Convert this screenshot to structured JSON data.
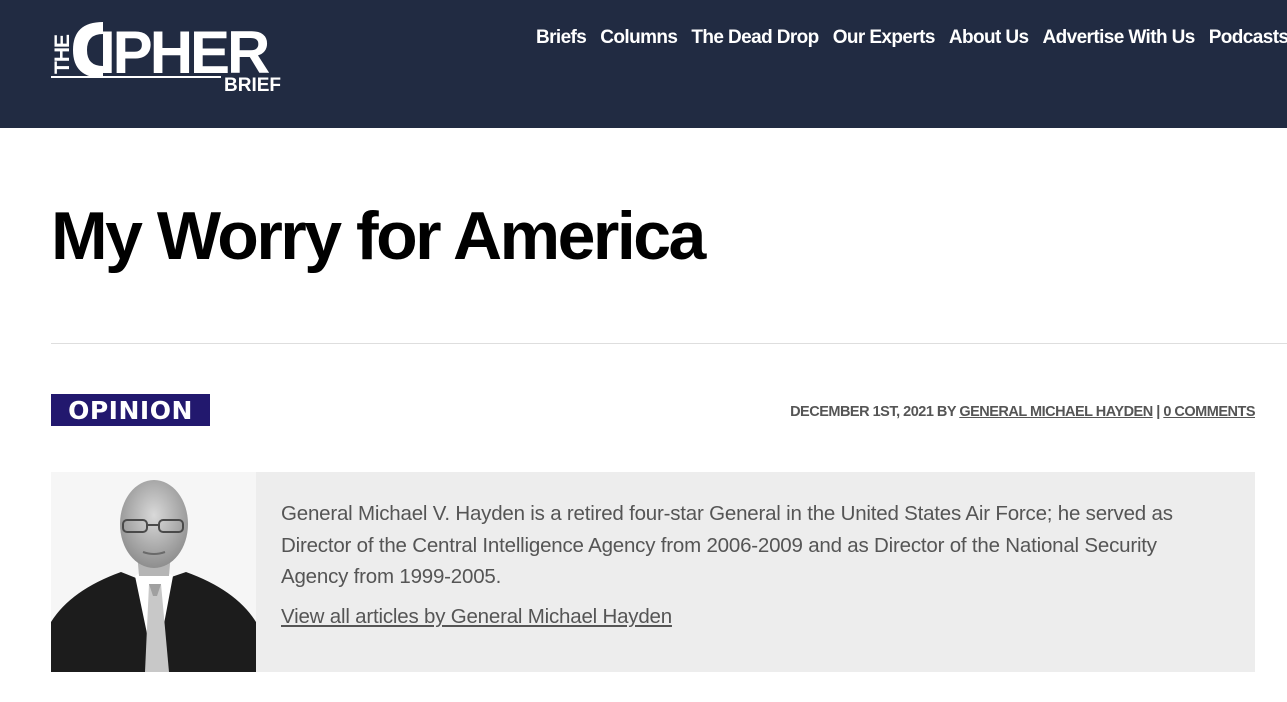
{
  "header": {
    "logo": {
      "the": "THE",
      "cipher": "CIPHER",
      "brief": "BRIEF"
    },
    "nav": [
      {
        "label": "Briefs",
        "name": "nav-briefs"
      },
      {
        "label": "Columns",
        "name": "nav-columns"
      },
      {
        "label": "The Dead Drop",
        "name": "nav-the-dead-drop"
      },
      {
        "label": "Our Experts",
        "name": "nav-our-experts"
      },
      {
        "label": "About Us",
        "name": "nav-about-us"
      },
      {
        "label": "Advertise With Us",
        "name": "nav-advertise-with-us"
      },
      {
        "label": "Podcasts",
        "name": "nav-podcasts"
      }
    ]
  },
  "article": {
    "title": "My Worry for America",
    "category": "OPINION",
    "date_prefix": "DECEMBER 1ST, 2021 BY ",
    "author_link": "GENERAL MICHAEL HAYDEN",
    "separator": " | ",
    "comments": "0 COMMENTS"
  },
  "author_box": {
    "bio": "General Michael V. Hayden is a retired four-star General in the United States Air Force; he served as Director of the Central Intelligence Agency from 2006-2009 and as Director of the National Security Agency from 1999-2005.",
    "view_all": "View all articles by General Michael Hayden"
  },
  "colors": {
    "header_bg": "#212b42",
    "badge_bg": "#22186e",
    "author_box_bg": "#ededed",
    "meta_text": "#555555"
  }
}
